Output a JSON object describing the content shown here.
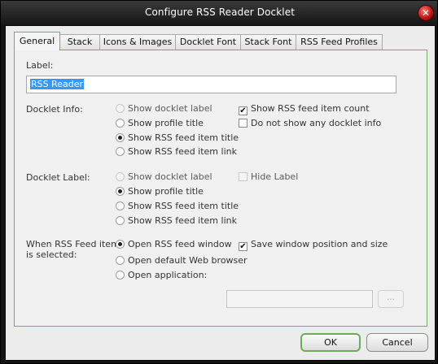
{
  "window": {
    "title": "Configure RSS Reader Docklet",
    "close_glyph": "✕"
  },
  "tabs": [
    {
      "label": "General",
      "active": true
    },
    {
      "label": "Stack",
      "active": false
    },
    {
      "label": "Icons & Images",
      "active": false
    },
    {
      "label": "Docklet Font",
      "active": false
    },
    {
      "label": "Stack Font",
      "active": false
    },
    {
      "label": "RSS Feed Profiles",
      "active": false
    }
  ],
  "general": {
    "label_caption": "Label:",
    "label_value": "RSS Reader",
    "docklet_info": {
      "caption": "Docklet Info:",
      "options": [
        {
          "label": "Show docklet label",
          "selected": false,
          "enabled": false
        },
        {
          "label": "Show profile title",
          "selected": false,
          "enabled": true
        },
        {
          "label": "Show RSS feed item title",
          "selected": true,
          "enabled": true
        },
        {
          "label": "Show RSS feed item link",
          "selected": false,
          "enabled": true
        }
      ],
      "show_count": {
        "label": "Show RSS feed item count",
        "checked": true,
        "enabled": true
      },
      "hide_all": {
        "label": "Do not show any docklet info",
        "checked": false,
        "enabled": true
      }
    },
    "docklet_label": {
      "caption": "Docklet Label:",
      "options": [
        {
          "label": "Show docklet label",
          "selected": false,
          "enabled": false
        },
        {
          "label": "Show profile title",
          "selected": true,
          "enabled": true
        },
        {
          "label": "Show RSS feed item title",
          "selected": false,
          "enabled": true
        },
        {
          "label": "Show RSS feed item link",
          "selected": false,
          "enabled": true
        }
      ],
      "hide_label": {
        "label": "Hide Label",
        "checked": false,
        "enabled": false
      }
    },
    "on_select": {
      "caption_line1": "When RSS Feed item",
      "caption_line2": "is selected:",
      "options": [
        {
          "label": "Open RSS feed window",
          "selected": true,
          "enabled": true
        },
        {
          "label": "Open default Web browser",
          "selected": false,
          "enabled": true
        },
        {
          "label": "Open application:",
          "selected": false,
          "enabled": true
        }
      ],
      "save_position": {
        "label": "Save window position and size",
        "checked": true,
        "enabled": true
      },
      "browse_label": "...",
      "application_path": ""
    }
  },
  "buttons": {
    "ok": "OK",
    "cancel": "Cancel"
  },
  "colors": {
    "accent_green": "#7aa86a",
    "close_red": "#c01010",
    "selection_blue": "#3399ff"
  }
}
